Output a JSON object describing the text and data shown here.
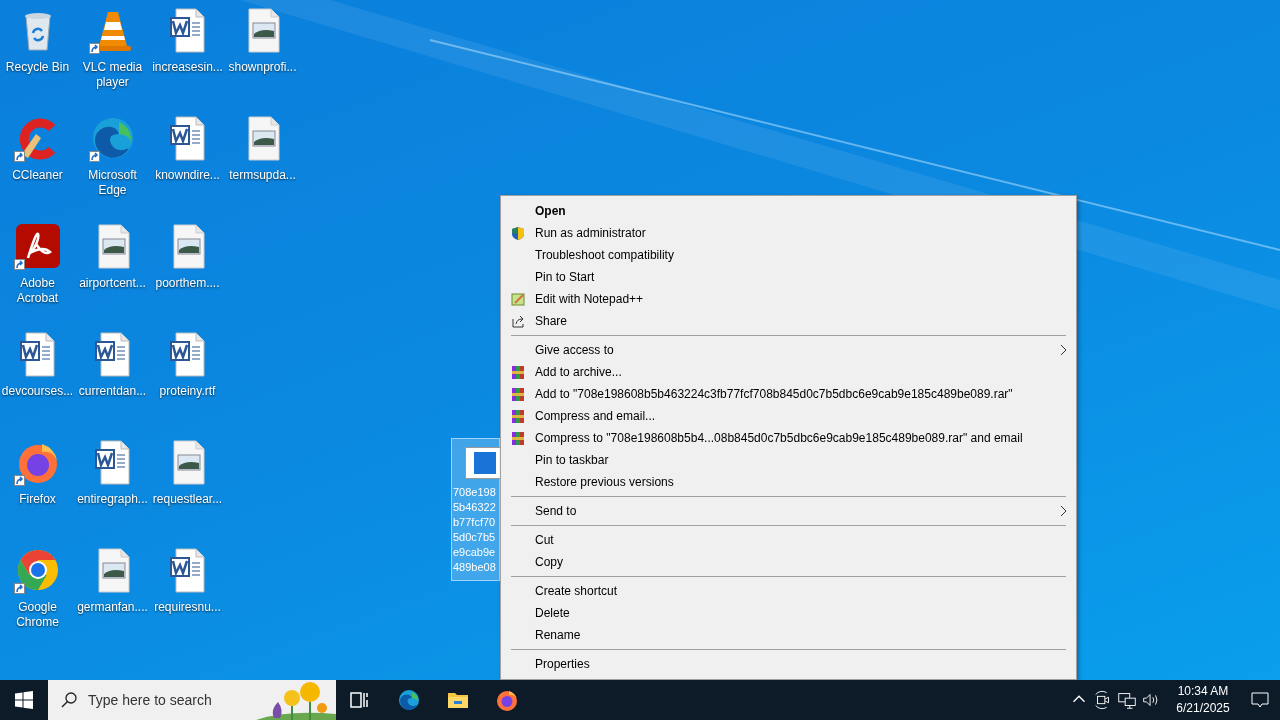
{
  "desktop_icons": [
    {
      "kind": "recycle",
      "label": "Recycle Bin",
      "shortcut": false
    },
    {
      "kind": "ccleaner",
      "label": "CCleaner",
      "shortcut": true
    },
    {
      "kind": "acrobat",
      "label": "Adobe Acrobat",
      "shortcut": true
    },
    {
      "kind": "word",
      "label": "devcourses...",
      "shortcut": false
    },
    {
      "kind": "firefox",
      "label": "Firefox",
      "shortcut": true
    },
    {
      "kind": "chrome",
      "label": "Google Chrome",
      "shortcut": true
    },
    {
      "kind": "vlc",
      "label": "VLC media player",
      "shortcut": true
    },
    {
      "kind": "edge",
      "label": "Microsoft Edge",
      "shortcut": true
    },
    {
      "kind": "image",
      "label": "airportcent...",
      "shortcut": false
    },
    {
      "kind": "word",
      "label": "currentdan...",
      "shortcut": false
    },
    {
      "kind": "word",
      "label": "entiregraph...",
      "shortcut": false
    },
    {
      "kind": "image",
      "label": "germanfan....",
      "shortcut": false
    },
    {
      "kind": "word",
      "label": "increasesin...",
      "shortcut": false
    },
    {
      "kind": "word",
      "label": "knowndire...",
      "shortcut": false
    },
    {
      "kind": "image",
      "label": "poorthem....",
      "shortcut": false
    },
    {
      "kind": "word",
      "label": "proteiny.rtf",
      "shortcut": false
    },
    {
      "kind": "image",
      "label": "requestlear...",
      "shortcut": false
    },
    {
      "kind": "word",
      "label": "requiresnu...",
      "shortcut": false
    },
    {
      "kind": "image",
      "label": "shownprofi...",
      "shortcut": false
    },
    {
      "kind": "image",
      "label": "termsupda...",
      "shortcut": false
    }
  ],
  "selected_file": {
    "selected": true,
    "name_lines": [
      "708e198",
      "5b46322",
      "b77fcf70",
      "5d0c7b5",
      "e9cab9e",
      "489be08"
    ]
  },
  "context_menu": [
    {
      "kind": "item",
      "label": "Open",
      "default": true
    },
    {
      "kind": "admin",
      "label": "Run as administrator"
    },
    {
      "kind": "item",
      "label": "Troubleshoot compatibility"
    },
    {
      "kind": "item",
      "label": "Pin to Start"
    },
    {
      "kind": "notepad",
      "label": "Edit with Notepad++"
    },
    {
      "kind": "share",
      "label": "Share"
    },
    {
      "kind": "separator"
    },
    {
      "kind": "item",
      "label": "Give access to",
      "submenu": true
    },
    {
      "kind": "archive",
      "label": "Add to archive..."
    },
    {
      "kind": "archive",
      "label": "Add to \"708e198608b5b463224c3fb77fcf708b845d0c7b5dbc6e9cab9e185c489be089.rar\""
    },
    {
      "kind": "archive",
      "label": "Compress and email..."
    },
    {
      "kind": "archive",
      "label": "Compress to \"708e198608b5b4...08b845d0c7b5dbc6e9cab9e185c489be089.rar\" and email"
    },
    {
      "kind": "item",
      "label": "Pin to taskbar"
    },
    {
      "kind": "item",
      "label": "Restore previous versions"
    },
    {
      "kind": "separator"
    },
    {
      "kind": "item",
      "label": "Send to",
      "submenu": true
    },
    {
      "kind": "separator"
    },
    {
      "kind": "item",
      "label": "Cut"
    },
    {
      "kind": "item",
      "label": "Copy"
    },
    {
      "kind": "separator"
    },
    {
      "kind": "item",
      "label": "Create shortcut"
    },
    {
      "kind": "item",
      "label": "Delete"
    },
    {
      "kind": "item",
      "label": "Rename"
    },
    {
      "kind": "separator"
    },
    {
      "kind": "item",
      "label": "Properties"
    }
  ],
  "taskbar": {
    "search_placeholder": "Type here to search",
    "time": "10:34 AM",
    "date": "6/21/2025"
  }
}
